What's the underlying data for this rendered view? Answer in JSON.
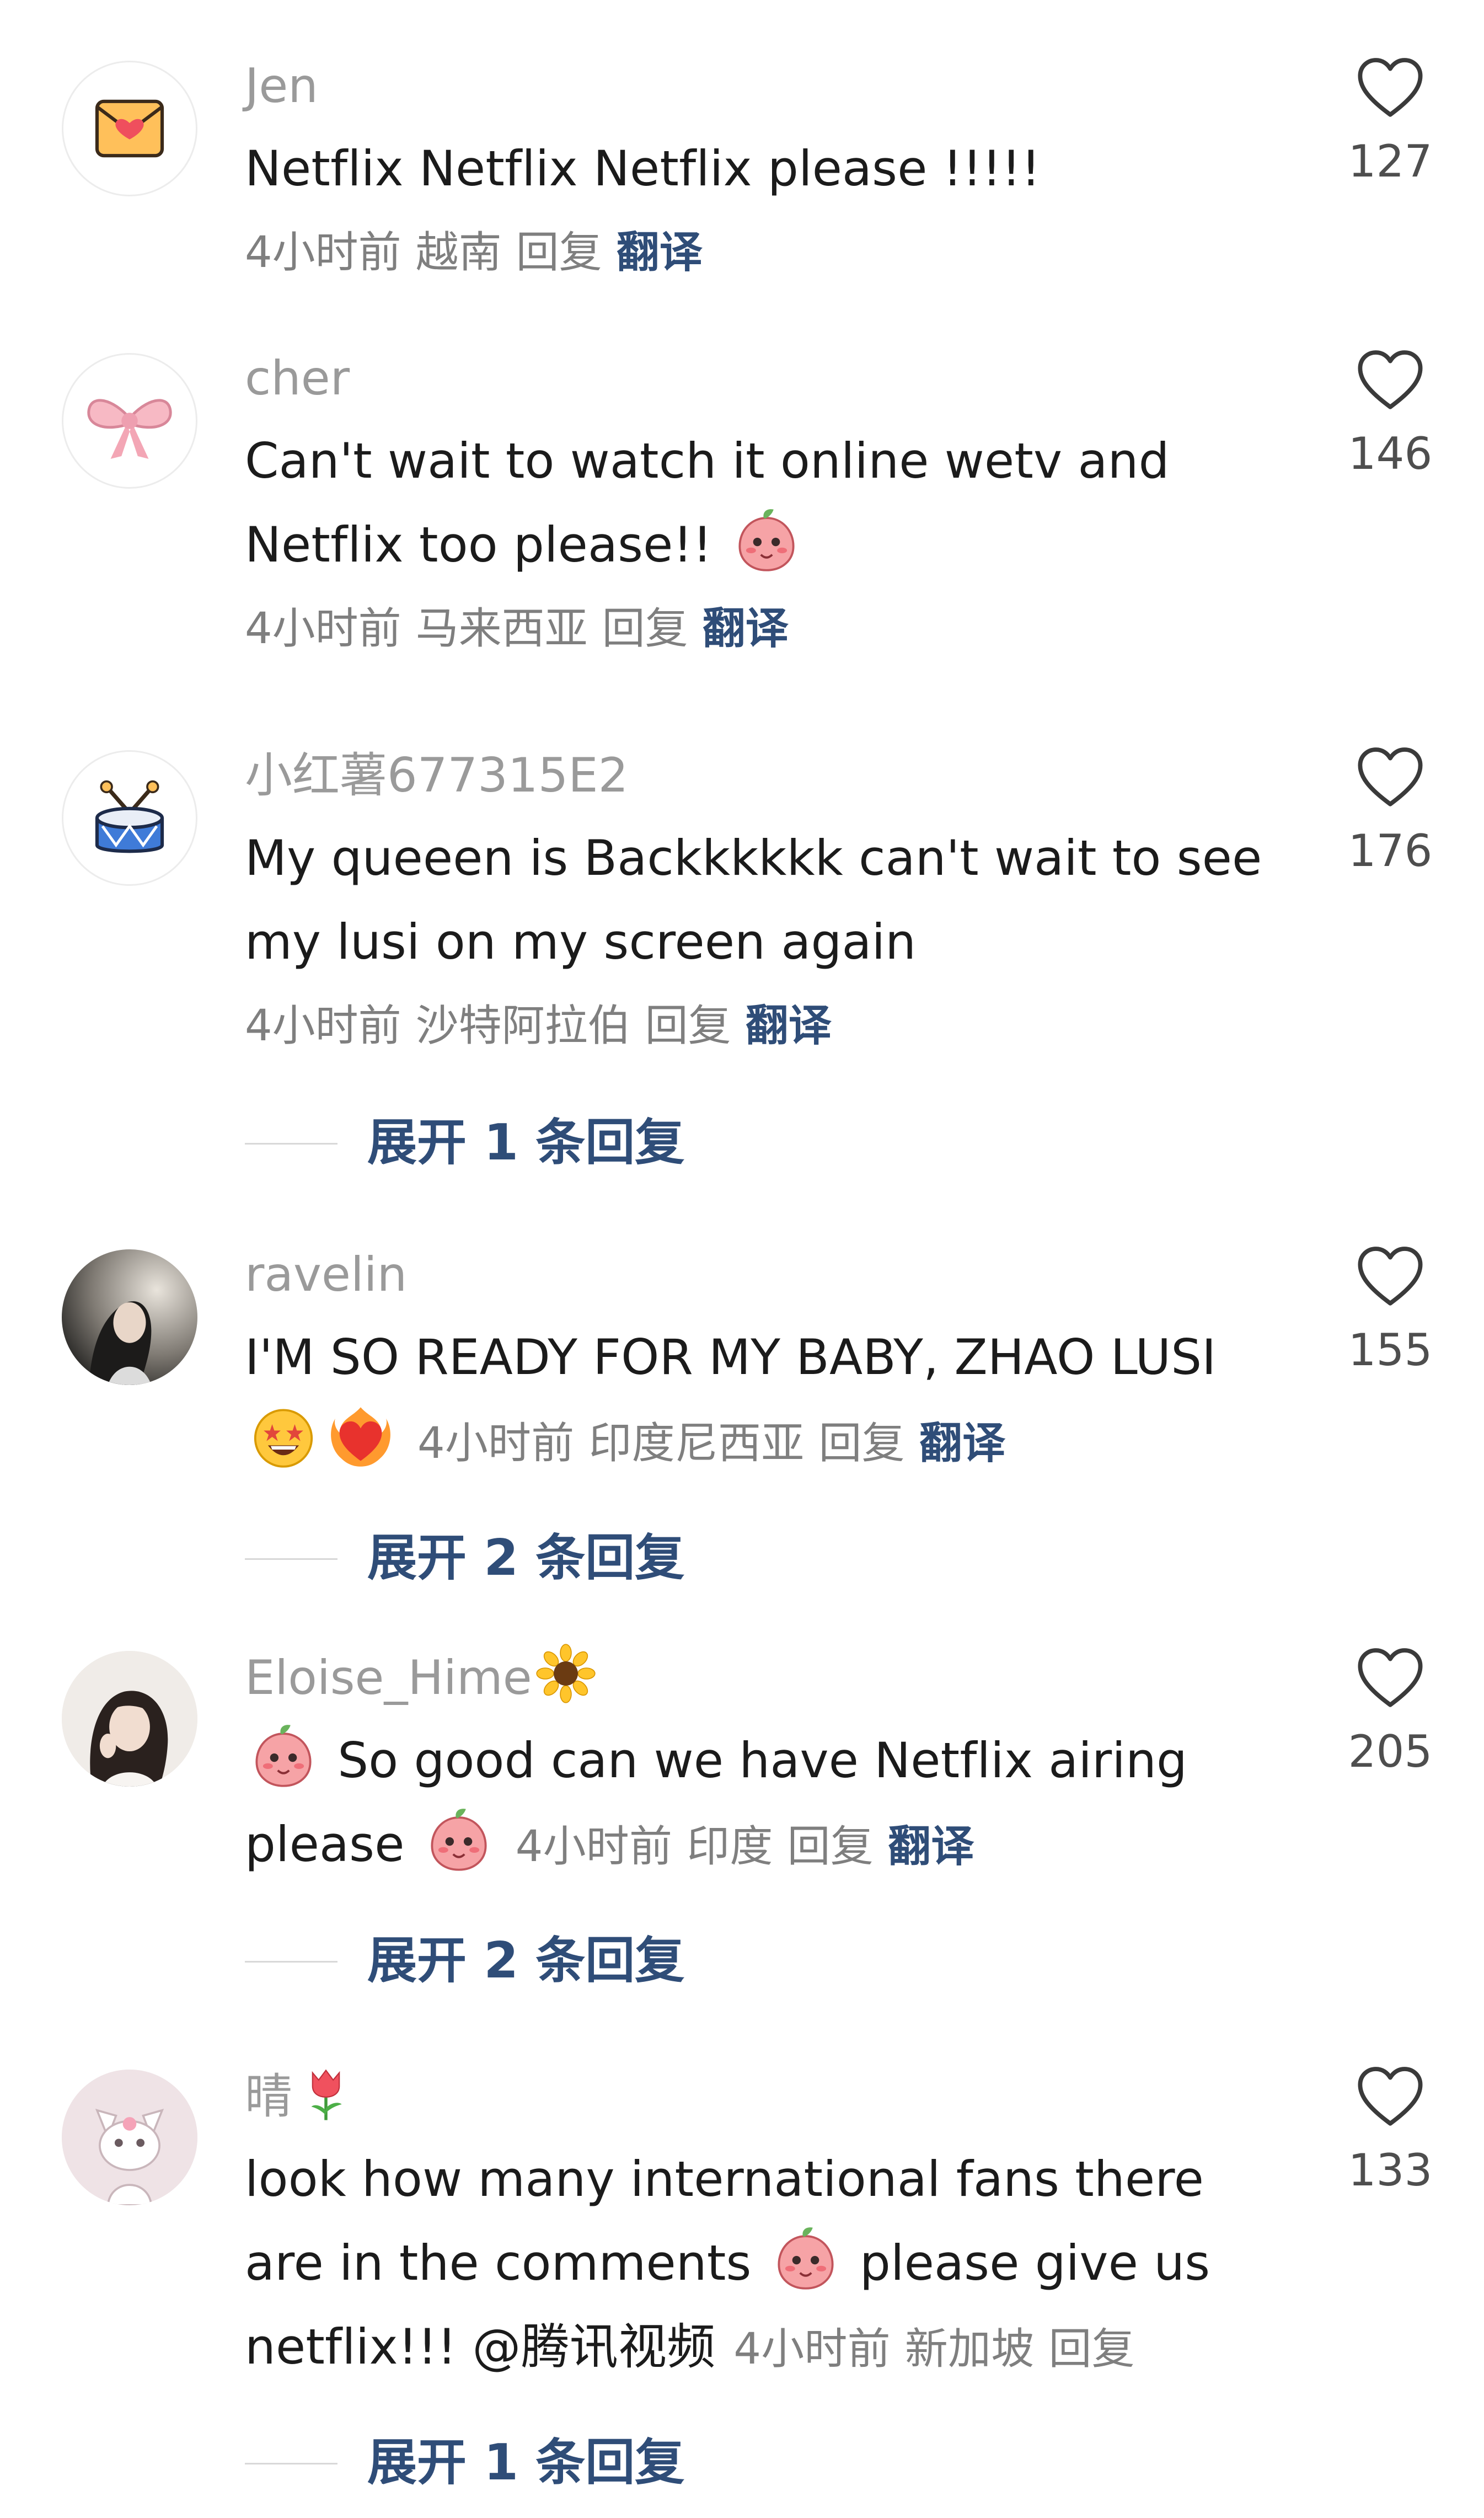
{
  "comments": [
    {
      "username": "Jen",
      "avatar_icon": "love-letter-icon",
      "text": "Netflix Netflix Netflix  please !!!!!",
      "time": "4小时前",
      "location": "越南",
      "reply": "回复",
      "translate": "翻译",
      "likes": "127"
    },
    {
      "username": "cher",
      "avatar_icon": "pink-bow-icon",
      "text_line1": "Can't wait to watch it online wetv and",
      "text_line2": "Netflix too please!!",
      "time": "4小时前",
      "location": "马来西亚",
      "reply": "回复",
      "translate": "翻译",
      "likes": "146"
    },
    {
      "username": "小红薯677315E2",
      "avatar_icon": "drum-icon",
      "text_line1": "My queeen is Backkkkkk can't wait to see",
      "text_line2": "my lusi on my screen again",
      "time": "4小时前",
      "location": "沙特阿拉伯",
      "reply": "回复",
      "translate": "翻译",
      "likes": "176",
      "expand": "展开 1 条回复"
    },
    {
      "username": "ravelin",
      "avatar_icon": "user-photo-avatar",
      "text_line1": "I'M SO READY FOR MY BABY, ZHAO LUSI",
      "time": "4小时前",
      "location": "印度尼西亚",
      "reply": "回复",
      "translate": "翻译",
      "likes": "155",
      "expand": "展开 2 条回复"
    },
    {
      "username": "Eloise_Hime",
      "avatar_icon": "user-photo-avatar",
      "text_line1": "So good can we have Netflix airing",
      "text_line2": "please",
      "time": "4小时前",
      "location": "印度",
      "reply": "回复",
      "translate": "翻译",
      "likes": "205",
      "expand": "展开 2 条回复"
    },
    {
      "username": "晴",
      "avatar_icon": "cat-avatar",
      "text_line1": "look how many international fans there",
      "text_line2_a": "are in the comments",
      "text_line2_b": "please give us",
      "text_line3": "netflix!!! @腾讯视频",
      "time": "4小时前",
      "location": "新加坡",
      "reply": "回复",
      "likes": "133",
      "expand": "展开 1 条回复"
    }
  ],
  "icons": {
    "heart": "heart-outline-icon",
    "emoji_peach": "peach-emoji-icon",
    "emoji_star_eyes": "star-struck-emoji-icon",
    "emoji_fire_heart": "heart-on-fire-emoji-icon",
    "emoji_sunflower": "sunflower-emoji-icon",
    "emoji_tulip": "tulip-emoji-icon"
  },
  "colors": {
    "username": "#9a9a9a",
    "text": "#1b1b1b",
    "meta": "#7f7f7f",
    "link": "#2f4d78",
    "like_count": "#4e4e4e"
  }
}
